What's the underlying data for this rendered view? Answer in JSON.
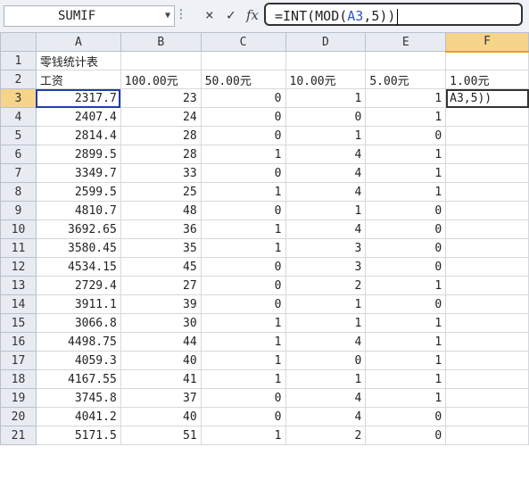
{
  "formula_bar": {
    "name_box": "SUMIF",
    "cancel_glyph": "×",
    "enter_glyph": "✓",
    "func_glyph": "fx",
    "formula_pre": "=INT(MOD(",
    "formula_ref": "A3",
    "formula_post": ",5))"
  },
  "grid": {
    "columns": [
      "A",
      "B",
      "C",
      "D",
      "E",
      "F"
    ],
    "selected_column": "F",
    "selected_row": 3,
    "rows": [
      {
        "n": 1,
        "cells": [
          "零钱统计表",
          "",
          "",
          "",
          "",
          ""
        ]
      },
      {
        "n": 2,
        "cells": [
          "工资",
          "100.00元",
          "50.00元",
          "10.00元",
          "5.00元",
          "1.00元"
        ]
      },
      {
        "n": 3,
        "cells": [
          "2317.7",
          "23",
          "0",
          "1",
          "1",
          "A3,5))"
        ]
      },
      {
        "n": 4,
        "cells": [
          "2407.4",
          "24",
          "0",
          "0",
          "1",
          ""
        ]
      },
      {
        "n": 5,
        "cells": [
          "2814.4",
          "28",
          "0",
          "1",
          "0",
          ""
        ]
      },
      {
        "n": 6,
        "cells": [
          "2899.5",
          "28",
          "1",
          "4",
          "1",
          ""
        ]
      },
      {
        "n": 7,
        "cells": [
          "3349.7",
          "33",
          "0",
          "4",
          "1",
          ""
        ]
      },
      {
        "n": 8,
        "cells": [
          "2599.5",
          "25",
          "1",
          "4",
          "1",
          ""
        ]
      },
      {
        "n": 9,
        "cells": [
          "4810.7",
          "48",
          "0",
          "1",
          "0",
          ""
        ]
      },
      {
        "n": 10,
        "cells": [
          "3692.65",
          "36",
          "1",
          "4",
          "0",
          ""
        ]
      },
      {
        "n": 11,
        "cells": [
          "3580.45",
          "35",
          "1",
          "3",
          "0",
          ""
        ]
      },
      {
        "n": 12,
        "cells": [
          "4534.15",
          "45",
          "0",
          "3",
          "0",
          ""
        ]
      },
      {
        "n": 13,
        "cells": [
          "2729.4",
          "27",
          "0",
          "2",
          "1",
          ""
        ]
      },
      {
        "n": 14,
        "cells": [
          "3911.1",
          "39",
          "0",
          "1",
          "0",
          ""
        ]
      },
      {
        "n": 15,
        "cells": [
          "3066.8",
          "30",
          "1",
          "1",
          "1",
          ""
        ]
      },
      {
        "n": 16,
        "cells": [
          "4498.75",
          "44",
          "1",
          "4",
          "1",
          ""
        ]
      },
      {
        "n": 17,
        "cells": [
          "4059.3",
          "40",
          "1",
          "0",
          "1",
          ""
        ]
      },
      {
        "n": 18,
        "cells": [
          "4167.55",
          "41",
          "1",
          "1",
          "1",
          ""
        ]
      },
      {
        "n": 19,
        "cells": [
          "3745.8",
          "37",
          "0",
          "4",
          "1",
          ""
        ]
      },
      {
        "n": 20,
        "cells": [
          "4041.2",
          "40",
          "0",
          "4",
          "0",
          ""
        ]
      },
      {
        "n": 21,
        "cells": [
          "5171.5",
          "51",
          "1",
          "2",
          "0",
          ""
        ]
      }
    ]
  }
}
